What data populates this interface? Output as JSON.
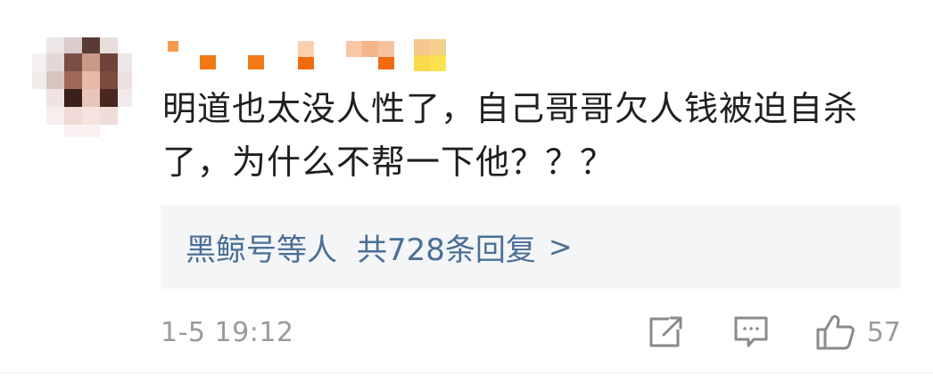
{
  "comment": {
    "author_name": "",
    "text": "明道也太没人性了，自己哥哥欠人钱被迫自杀了，为什么不帮一下他？？？",
    "replies": {
      "names": "黑鲸号等人",
      "summary": "共728条回复",
      "arrow": ">"
    },
    "timestamp": "1-5 19:12",
    "like_count": "57",
    "icons": {
      "share": "share-edit-icon",
      "reply": "comment-bubble-icon",
      "like": "thumbs-up-icon"
    }
  }
}
